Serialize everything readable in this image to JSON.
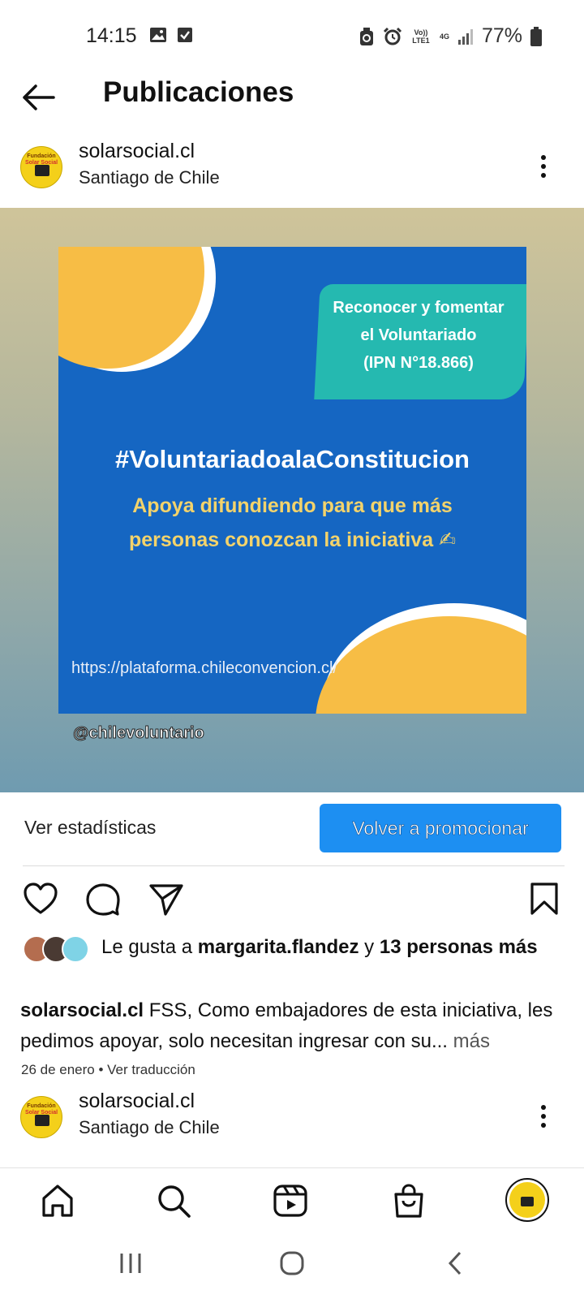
{
  "status_bar": {
    "time": "14:15",
    "battery": "77%",
    "volte": "Vo)) LTE1",
    "network": "4G",
    "icons": [
      "gallery-icon",
      "checkbox-icon",
      "recycle-icon",
      "alarm-icon",
      "signal-icon",
      "battery-icon"
    ]
  },
  "header": {
    "title": "Publicaciones"
  },
  "post": {
    "username": "solarsocial.cl",
    "location": "Santiago de Chile",
    "avatar_text": "Fundación Solar Social",
    "image": {
      "teal_box_lines": [
        "Reconocer y fomentar",
        "el Voluntariado",
        "(IPN N°18.866)"
      ],
      "hashtag": "#VoluntariadoalaConstitucion",
      "subtitle_lines": [
        "Apoya difundiendo para que más",
        "personas conozcan la iniciativa ✍"
      ],
      "url": "https://plataforma.chileconvencion.cl/",
      "handle": "@chilevoluntario"
    },
    "stats_label": "Ver estadísticas",
    "promote_label": "Volver a promocionar",
    "likes": {
      "prefix": "Le gusta a ",
      "user": "margarita.flandez",
      "connector": " y ",
      "others": "13 personas más"
    },
    "caption": {
      "user": "solarsocial.cl",
      "text": " FSS, Como embajadores de esta iniciativa, les pedimos apoyar, solo necesitan ingresar con su...",
      "more": " más"
    },
    "date": "26 de enero",
    "translate": "Ver traducción"
  },
  "next_post": {
    "username": "solarsocial.cl",
    "location": "Santiago de Chile"
  },
  "colors": {
    "accent": "#1d8ff2",
    "poster_blue": "#1566c2",
    "poster_yellow": "#f7bd45",
    "poster_teal": "#25b9b0"
  }
}
